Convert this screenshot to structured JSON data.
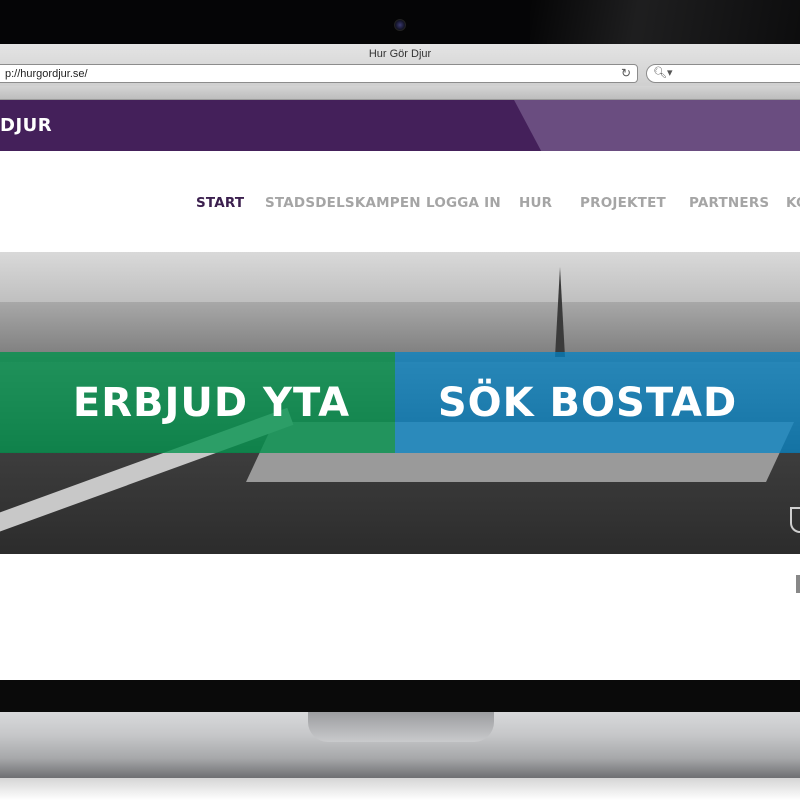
{
  "browser": {
    "window_title": "Hur Gör Djur",
    "url": "p://hurgordjur.se/"
  },
  "site": {
    "logo_text": "DJUR"
  },
  "nav": {
    "items": [
      {
        "label": "START",
        "active": true
      },
      {
        "label": "STADSDELSKAMPEN",
        "active": false
      },
      {
        "label": "LOGGA IN",
        "active": false
      },
      {
        "label": "HUR",
        "active": false
      },
      {
        "label": "PROJEKTET",
        "active": false
      },
      {
        "label": "PARTNERS",
        "active": false
      },
      {
        "label": "KO",
        "active": false
      }
    ]
  },
  "hero": {
    "cta_left": "ERBJUD YTA",
    "cta_right": "SÖK BOSTAD"
  },
  "colors": {
    "header_purple": "#44205a",
    "active_nav": "#3b1f4e",
    "cta_green": "#00924b",
    "cta_blue": "#0084c8"
  }
}
